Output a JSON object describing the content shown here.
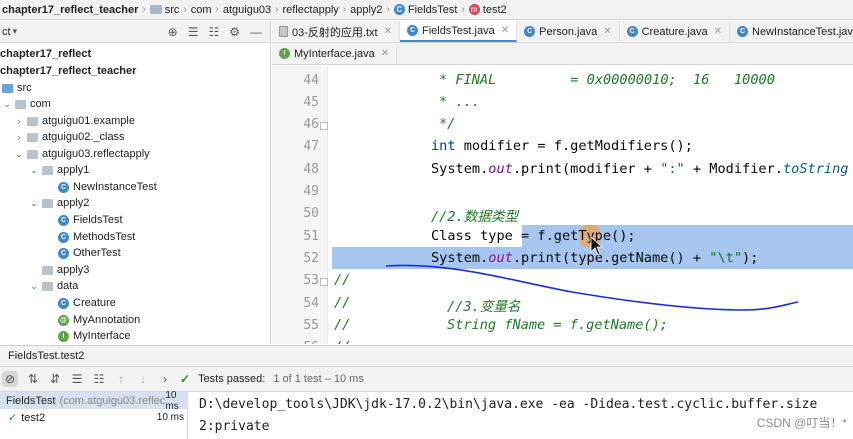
{
  "breadcrumb": {
    "items": [
      "chapter17_reflect_teacher",
      "src",
      "com",
      "atguigu03",
      "reflectapply",
      "apply2",
      "FieldsTest",
      "test2"
    ]
  },
  "project_panel": {
    "title": "ct"
  },
  "tree": {
    "rows": [
      {
        "label": "chapter17_reflect",
        "bold": true
      },
      {
        "label": "chapter17_reflect_teacher",
        "bold": true
      },
      {
        "label": "src"
      },
      {
        "label": "com"
      },
      {
        "label": "atguigu01.example"
      },
      {
        "label": "atguigu02._class"
      },
      {
        "label": "atguigu03.reflectapply"
      },
      {
        "label": "apply1"
      },
      {
        "label": "NewInstanceTest"
      },
      {
        "label": "apply2"
      },
      {
        "label": "FieldsTest"
      },
      {
        "label": "MethodsTest"
      },
      {
        "label": "OtherTest"
      },
      {
        "label": "apply3"
      },
      {
        "label": "data"
      },
      {
        "label": "Creature"
      },
      {
        "label": "MyAnnotation"
      },
      {
        "label": "MyInterface"
      }
    ]
  },
  "tabs": {
    "row1": [
      "03-反射的应用.txt",
      "FieldsTest.java",
      "Person.java",
      "Creature.java",
      "NewInstanceTest.java"
    ],
    "row2": [
      "MyInterface.java"
    ]
  },
  "editor": {
    "line_numbers": [
      "44",
      "45",
      "46",
      "47",
      "48",
      "49",
      "50",
      "51",
      "52",
      "53",
      "54",
      "55",
      "56"
    ],
    "lines": {
      "l44a": "* FINAL",
      "l44b": "= 0x00000010;  16   10000",
      "l45": "* ...",
      "l46": "*/",
      "l47_kw": "int",
      "l47_rest": " modifier = f.getModifiers();",
      "l48_a": "System.",
      "l48_fld": "out",
      "l48_b": ".print(modifier + ",
      "l48_str": "\":\"",
      "l48_c": " + Modifier.",
      "l48_sm": "toString",
      "l50": "//2.数据类型",
      "l51": "Class type = f.getType();",
      "l52_a": "System.",
      "l52_fld": "out",
      "l52_b": ".print(type.getName() + ",
      "l52_str": "\"\\t\"",
      "l52_c": ");",
      "l53": "//",
      "l54a": "//",
      "l54b": "//3.变量名",
      "l55a": "//",
      "l55b": "String fName = f.getName();",
      "l56": "//"
    }
  },
  "run": {
    "title": "FieldsTest.test2",
    "status": "Tests passed:",
    "status_detail": "1 of 1 test – 10 ms",
    "tests": [
      {
        "name": "FieldsTest",
        "pkg": "(com.atguigu03.reflec",
        "duration": "10 ms"
      },
      {
        "name": "test2",
        "duration": "10 ms"
      }
    ],
    "console": [
      "D:\\develop_tools\\JDK\\jdk-17.0.2\\bin\\java.exe -ea -Didea.test.cyclic.buffer.size",
      "2:private"
    ]
  },
  "watermark": "CSDN @叮当！*"
}
